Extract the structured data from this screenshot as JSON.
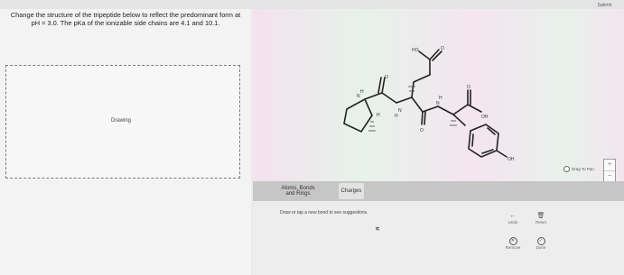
{
  "header": {
    "submit_label": "Submit"
  },
  "question": {
    "text": "Change the structure of the tripeptide below to reflect the predominant form at pH = 3.0. The pKa of the ionizable side chains are 4.1 and 10.1."
  },
  "drawing_area": {
    "label": "Drawing"
  },
  "molecule": {
    "atom_labels": {
      "ho": "HO",
      "o_top": "O",
      "n1": "N",
      "h1": "H",
      "o_left": "O",
      "h_alpha": "H",
      "n2": "N",
      "h2": "H",
      "o_mid": "O",
      "n3": "N",
      "h3": "H",
      "o_right": "O",
      "oh_acid": "OH",
      "oh_phenol": "OH"
    }
  },
  "canvas_controls": {
    "drag_to_pan": "Drag To Pan",
    "zoom_in": "+",
    "zoom_out": "−"
  },
  "tabs": [
    {
      "label": "Atoms, Bonds and Rings"
    },
    {
      "label": "Charges"
    }
  ],
  "tool_panel": {
    "hint": "Draw or tap a new bond to see suggestions.",
    "undo": "Undo",
    "reset": "Reset",
    "remove": "Remove",
    "done": "Done"
  }
}
